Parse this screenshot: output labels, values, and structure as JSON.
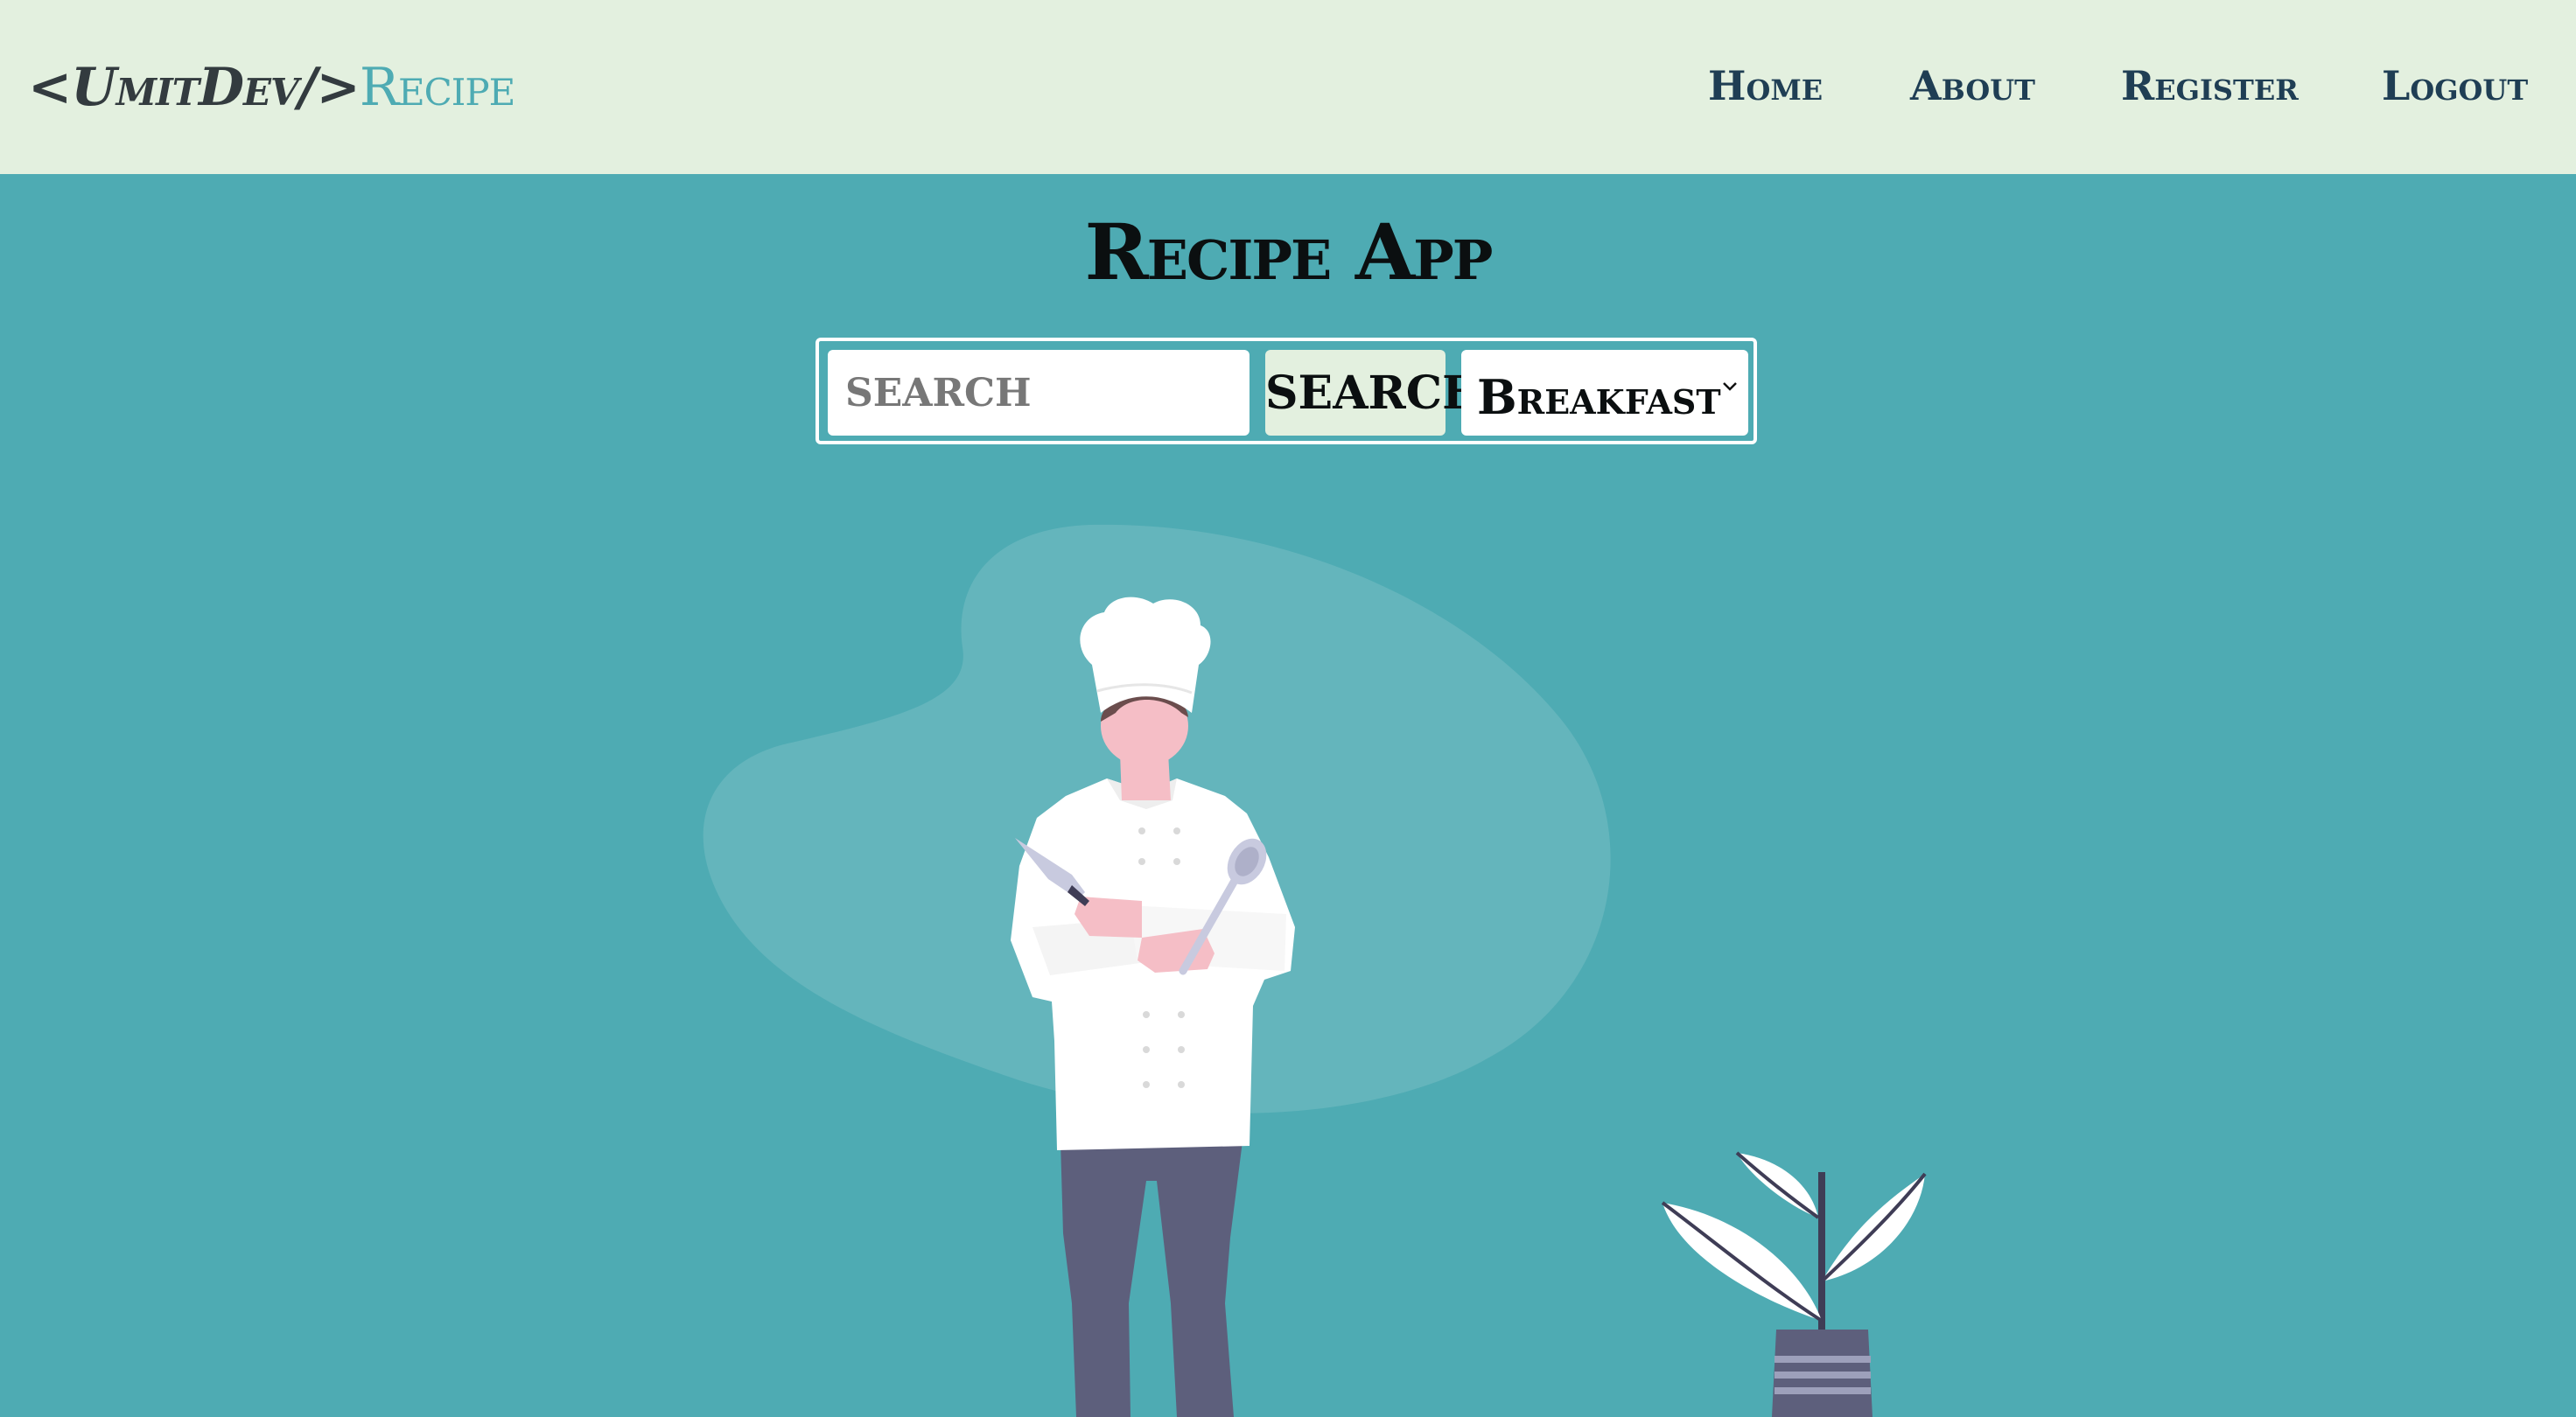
{
  "navbar": {
    "brand_prefix": "<UmitDev/>",
    "brand_suffix": "Recipe",
    "links": [
      {
        "label": "Home"
      },
      {
        "label": "About"
      },
      {
        "label": "Register"
      },
      {
        "label": "Logout"
      }
    ]
  },
  "main": {
    "title": "Recipe App",
    "search": {
      "placeholder": "SEARCH",
      "value": "",
      "button_label": "SEARCH"
    },
    "category": {
      "selected": "Breakfast",
      "icon": "chevron-down-icon"
    }
  },
  "illustration": {
    "subject": "chef-illustration",
    "decoration": "potted-plant-illustration"
  },
  "colors": {
    "background": "#4eabb3",
    "navbar": "#e3f0df",
    "nav_text": "#1f3e54",
    "accent": "#4eabb3",
    "button": "#e3f0df"
  }
}
